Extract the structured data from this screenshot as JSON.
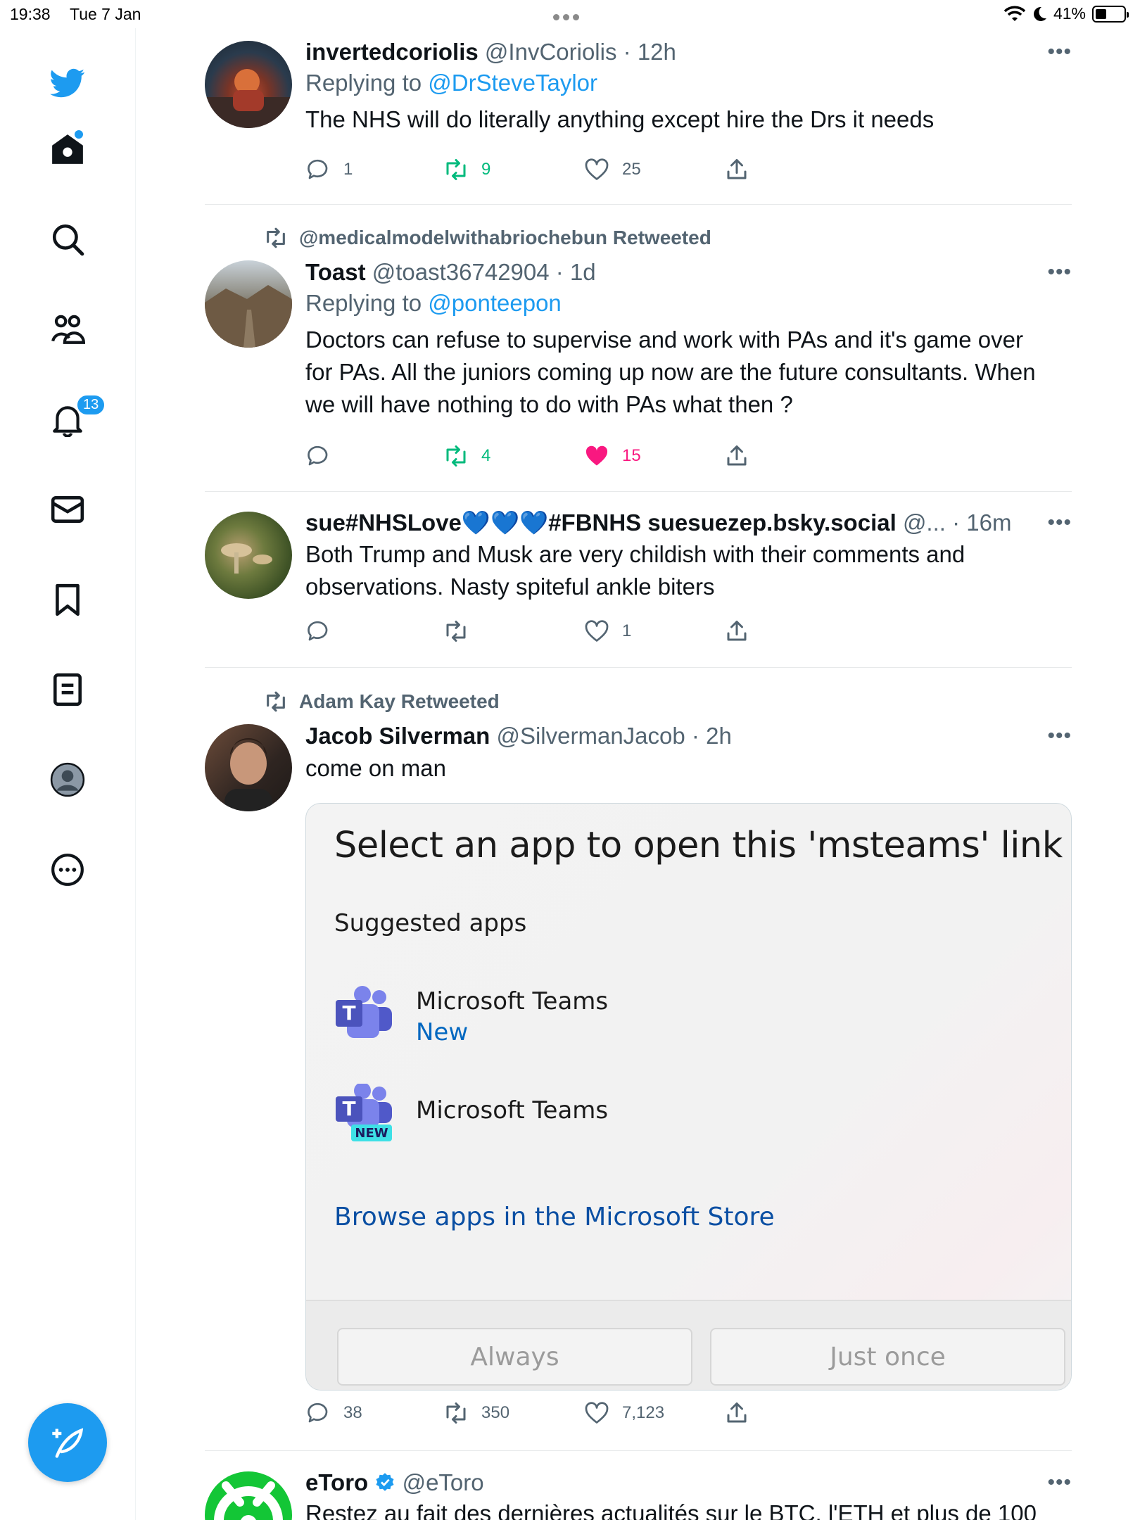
{
  "status_bar": {
    "time": "19:38",
    "date": "Tue 7 Jan",
    "battery": "41%"
  },
  "sidebar": {
    "notifications_count": "13"
  },
  "tweets": [
    {
      "name": "invertedcoriolis",
      "handle": "@InvCoriolis",
      "time": "12h",
      "replying_prefix": "Replying to",
      "replying_to": "@DrSteveTaylor",
      "text": "The NHS will do literally anything except hire the Drs it needs",
      "replies": "1",
      "retweets": "9",
      "likes": "25"
    },
    {
      "retweeted_by": "@medicalmodelwithabriochebun Retweeted",
      "name": "Toast",
      "handle": "@toast36742904",
      "time": "1d",
      "replying_prefix": "Replying to",
      "replying_to": "@ponteepon",
      "text_lines": [
        "Doctors can refuse to supervise and work with PAs and it's game over",
        "for PAs. All the juniors coming up now are the future consultants. When",
        "we will have nothing to do with PAs what then ?"
      ],
      "replies": "",
      "retweets": "4",
      "likes": "15"
    },
    {
      "name": "sue#NHSLove💙💙💙#FBNHS suesuezep.bsky.social",
      "handle": "@...",
      "time": "16m",
      "text_lines": [
        "Both Trump and Musk are very childish with their comments and",
        "observations. Nasty spiteful ankle biters"
      ],
      "replies": "",
      "retweets": "",
      "likes": "1"
    },
    {
      "retweeted_by": "Adam Kay Retweeted",
      "name": "Jacob Silverman",
      "handle": "@SilvermanJacob",
      "time": "2h",
      "text": "come on man",
      "card": {
        "title": "Select an app to open this 'msteams' link",
        "subtitle": "Suggested apps",
        "app1_name": "Microsoft Teams",
        "app1_tag": "New",
        "app2_name": "Microsoft Teams",
        "app2_badge": "NEW",
        "link": "Browse apps in the Microsoft Store",
        "btn_always": "Always",
        "btn_once": "Just once"
      },
      "replies": "38",
      "retweets": "350",
      "likes": "7,123"
    },
    {
      "name": "eToro",
      "handle": "@eToro",
      "text": "Restez au fait des dernières actualités sur le BTC, l'ETH et plus de 100"
    }
  ],
  "colors": {
    "accent": "#1d9bf0",
    "retweet": "#00ba7c",
    "like": "#f91880",
    "muted": "#536471"
  }
}
